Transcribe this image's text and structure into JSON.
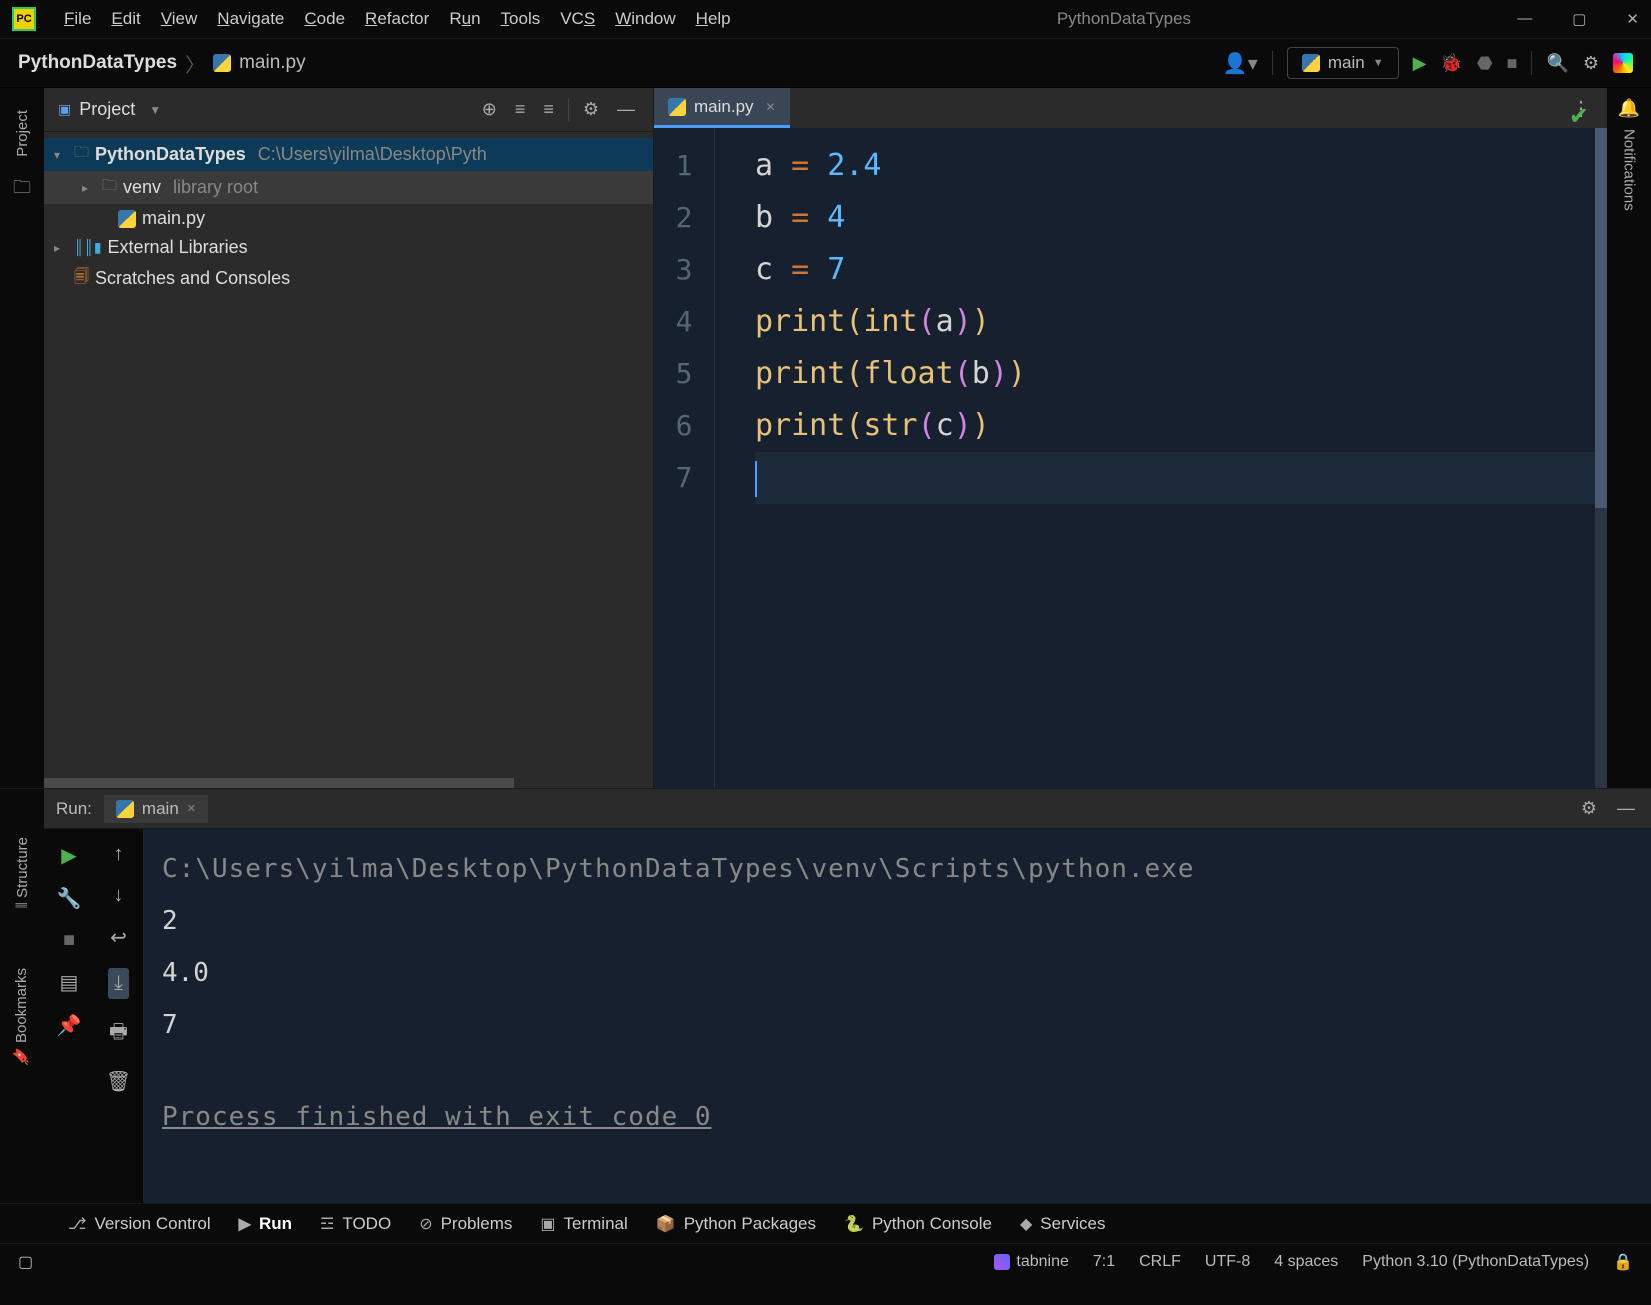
{
  "titlebar": {
    "app_badge": "PC",
    "menu": [
      "File",
      "Edit",
      "View",
      "Navigate",
      "Code",
      "Refactor",
      "Run",
      "Tools",
      "VCS",
      "Window",
      "Help"
    ],
    "window_title": "PythonDataTypes"
  },
  "navbar": {
    "breadcrumb_project": "PythonDataTypes",
    "breadcrumb_file": "main.py",
    "run_config": "main"
  },
  "project_panel": {
    "title": "Project",
    "root_name": "PythonDataTypes",
    "root_path": "C:\\Users\\yilma\\Desktop\\Pyth",
    "venv_name": "venv",
    "venv_tag": "library root",
    "file1": "main.py",
    "ext_libs": "External Libraries",
    "scratches": "Scratches and Consoles"
  },
  "editor": {
    "tab_name": "main.py",
    "gutter": [
      "1",
      "2",
      "3",
      "4",
      "5",
      "6",
      "7"
    ],
    "code": {
      "l1_a": "a",
      "l1_eq": " = ",
      "l1_v": "2.4",
      "l2_a": "b",
      "l2_eq": " = ",
      "l2_v": "4",
      "l3_a": "c",
      "l3_eq": " = ",
      "l3_v": "7",
      "l4_p": "print",
      "l4_o1": "(",
      "l4_fn": "int",
      "l4_o2": "(",
      "l4_arg": "a",
      "l4_c2": ")",
      "l4_c1": ")",
      "l5_p": "print",
      "l5_o1": "(",
      "l5_fn": "float",
      "l5_o2": "(",
      "l5_arg": "b",
      "l5_c2": ")",
      "l5_c1": ")",
      "l6_p": "print",
      "l6_o1": "(",
      "l6_fn": "str",
      "l6_o2": "(",
      "l6_arg": "c",
      "l6_c2": ")",
      "l6_c1": ")"
    }
  },
  "right_gutter": {
    "notifications": "Notifications"
  },
  "run_panel": {
    "label": "Run:",
    "tab": "main",
    "console": {
      "path": "C:\\Users\\yilma\\Desktop\\PythonDataTypes\\venv\\Scripts\\python.exe",
      "out1": "2",
      "out2": "4.0",
      "out3": "7",
      "exit": "Process finished with exit code 0"
    }
  },
  "left_labels": {
    "project": "Project",
    "structure": "Structure",
    "bookmarks": "Bookmarks"
  },
  "bottom_tools": {
    "vcs": "Version Control",
    "run": "Run",
    "todo": "TODO",
    "problems": "Problems",
    "terminal": "Terminal",
    "packages": "Python Packages",
    "console": "Python Console",
    "services": "Services"
  },
  "statusbar": {
    "tabnine": "tabnine",
    "position": "7:1",
    "lineend": "CRLF",
    "encoding": "UTF-8",
    "indent": "4 spaces",
    "interpreter": "Python 3.10 (PythonDataTypes)"
  }
}
